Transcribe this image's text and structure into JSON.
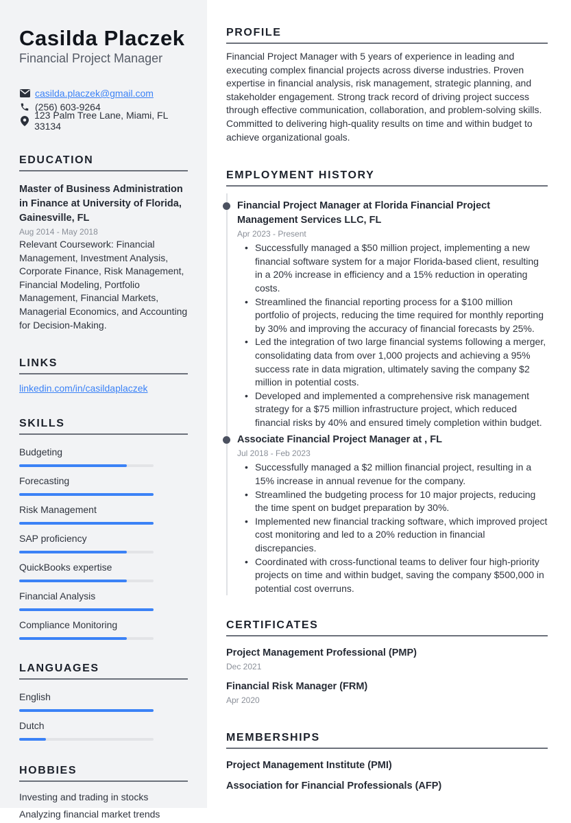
{
  "header": {
    "name": "Casilda Placzek",
    "title": "Financial Project Manager"
  },
  "contact": {
    "email": "casilda.placzek@gmail.com",
    "phone": "(256) 603-9264",
    "address": "123 Palm Tree Lane, Miami, FL 33134",
    "icons": [
      "envelope-icon",
      "phone-icon",
      "map-pin-icon"
    ]
  },
  "education": {
    "heading": "EDUCATION",
    "degree": "Master of Business Administration in Finance at University of Florida, Gainesville, FL",
    "dates": "Aug 2014 - May 2018",
    "description": "Relevant Coursework: Financial Management, Investment Analysis, Corporate Finance, Risk Management, Financial Modeling, Portfolio Management, Financial Markets, Managerial Economics, and Accounting for Decision-Making."
  },
  "links": {
    "heading": "LINKS",
    "items": [
      "linkedin.com/in/casildaplaczek"
    ]
  },
  "skills": {
    "heading": "SKILLS",
    "items": [
      {
        "label": "Budgeting",
        "level": 0.8
      },
      {
        "label": "Forecasting",
        "level": 1.0
      },
      {
        "label": "Risk Management",
        "level": 1.0
      },
      {
        "label": "SAP proficiency",
        "level": 0.8
      },
      {
        "label": "QuickBooks expertise",
        "level": 0.8
      },
      {
        "label": "Financial Analysis",
        "level": 1.0
      },
      {
        "label": "Compliance Monitoring",
        "level": 0.8
      }
    ]
  },
  "languages": {
    "heading": "LANGUAGES",
    "items": [
      {
        "label": "English",
        "level": 1.0
      },
      {
        "label": "Dutch",
        "level": 0.2
      }
    ]
  },
  "hobbies": {
    "heading": "HOBBIES",
    "items": [
      "Investing and trading in stocks",
      "Analyzing financial market trends"
    ]
  },
  "profile": {
    "heading": "PROFILE",
    "text": "Financial Project Manager with 5 years of experience in leading and executing complex financial projects across diverse industries. Proven expertise in financial analysis, risk management, strategic planning, and stakeholder engagement. Strong track record of driving project success through effective communication, collaboration, and problem-solving skills. Committed to delivering high-quality results on time and within budget to achieve organizational goals."
  },
  "employment": {
    "heading": "EMPLOYMENT HISTORY",
    "jobs": [
      {
        "title": "Financial Project Manager at Florida Financial Project Management Services LLC, FL",
        "dates": "Apr 2023 - Present",
        "bullets": [
          "Successfully managed a $50 million project, implementing a new financial software system for a major Florida-based client, resulting in a 20% increase in efficiency and a 15% reduction in operating costs.",
          "Streamlined the financial reporting process for a $100 million portfolio of projects, reducing the time required for monthly reporting by 30% and improving the accuracy of financial forecasts by 25%.",
          "Led the integration of two large financial systems following a merger, consolidating data from over 1,000 projects and achieving a 95% success rate in data migration, ultimately saving the company $2 million in potential costs.",
          "Developed and implemented a comprehensive risk management strategy for a $75 million infrastructure project, which reduced financial risks by 40% and ensured timely completion within budget."
        ]
      },
      {
        "title": "Associate Financial Project Manager at , FL",
        "dates": "Jul 2018 - Feb 2023",
        "bullets": [
          "Successfully managed a $2 million financial project, resulting in a 15% increase in annual revenue for the company.",
          "Streamlined the budgeting process for 10 major projects, reducing the time spent on budget preparation by 30%.",
          "Implemented new financial tracking software, which improved project cost monitoring and led to a 20% reduction in financial discrepancies.",
          "Coordinated with cross-functional teams to deliver four high-priority projects on time and within budget, saving the company $500,000 in potential cost overruns."
        ]
      }
    ]
  },
  "certificates": {
    "heading": "CERTIFICATES",
    "items": [
      {
        "title": "Project Management Professional (PMP)",
        "date": "Dec 2021"
      },
      {
        "title": "Financial Risk Manager (FRM)",
        "date": "Apr 2020"
      }
    ]
  },
  "memberships": {
    "heading": "MEMBERSHIPS",
    "items": [
      "Project Management Institute (PMI)",
      "Association for Financial Professionals (AFP)"
    ]
  },
  "colors": {
    "accent": "#3b82f6",
    "sidebar_bg": "#f2f3f5",
    "text": "#1f2430"
  }
}
